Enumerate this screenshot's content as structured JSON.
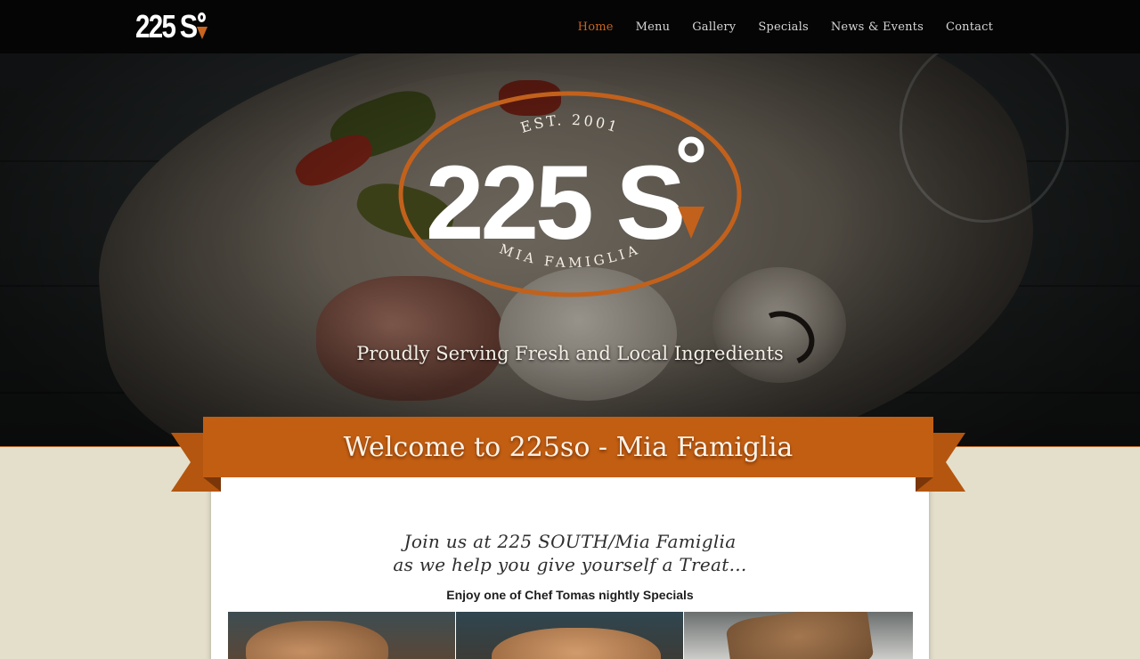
{
  "brand": {
    "number": "225",
    "letter": "S"
  },
  "nav": {
    "items": [
      {
        "label": "Home",
        "active": true
      },
      {
        "label": "Menu",
        "active": false
      },
      {
        "label": "Gallery",
        "active": false
      },
      {
        "label": "Specials",
        "active": false
      },
      {
        "label": "News & Events",
        "active": false
      },
      {
        "label": "Contact",
        "active": false
      }
    ]
  },
  "hero": {
    "emblem_top": "EST. 2001",
    "emblem_main": "225 S",
    "emblem_bottom": "MIA FAMIGLIA",
    "tagline": "Proudly Serving Fresh and Local Ingredients"
  },
  "welcome": {
    "title": "Welcome to 225so - Mia Famiglia",
    "intro_line1": "Join us at 225 SOUTH/Mia Famiglia",
    "intro_line2": "as we help you give yourself a Treat...",
    "subtitle": "Enjoy one of Chef Tomas nightly Specials"
  },
  "colors": {
    "accent": "#c8641f",
    "topbar": "#050505",
    "ribbon": "#c25e12",
    "ribbon_dark": "#8a3f0b",
    "content_bg": "#e4dfcb"
  },
  "icons": {
    "brand_marker": "degree-arrow-icon"
  }
}
